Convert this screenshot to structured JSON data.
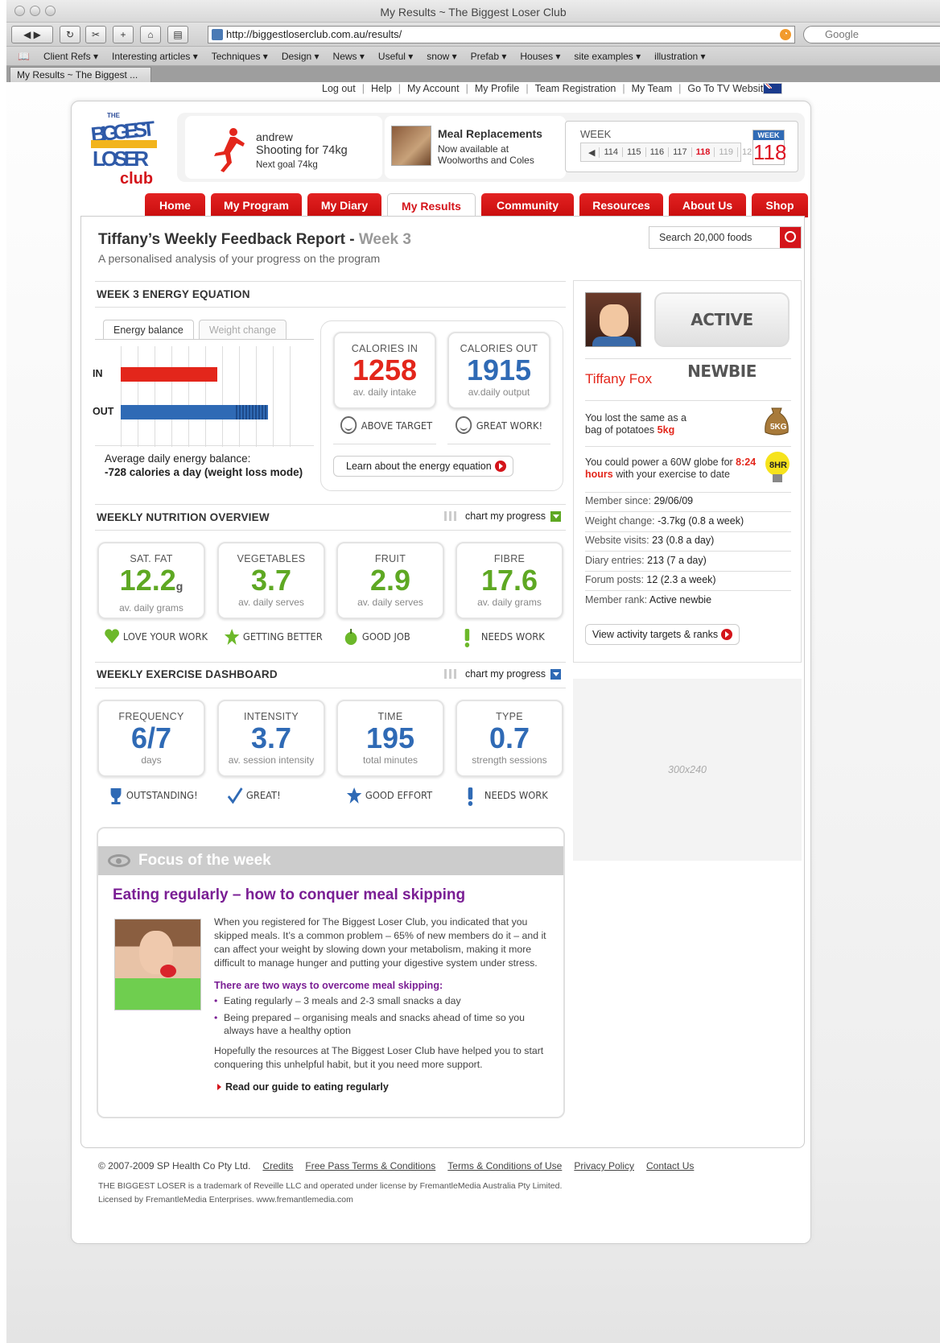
{
  "window": {
    "title": "My Results ~ The Biggest Loser Club",
    "url": "http://biggestloserclub.com.au/results/",
    "search_placeholder": "Google",
    "tab_label": "My Results ~ The Biggest ..."
  },
  "bookmarks": [
    "Client Refs ▾",
    "Interesting articles ▾",
    "Techniques ▾",
    "Design ▾",
    "News ▾",
    "Useful ▾",
    "snow ▾",
    "Prefab ▾",
    "Houses ▾",
    "site examples ▾",
    "illustration ▾"
  ],
  "topnav": [
    "Log out",
    "Help",
    "My Account",
    "My Profile",
    "Team Registration",
    "My Team",
    "Go To TV Website"
  ],
  "logo": {
    "line1": "THE",
    "line2": "BIGGEST",
    "line3": "LOSER",
    "line4": "club"
  },
  "profile": {
    "name": "andrew",
    "shooting": "Shooting for 74kg",
    "next_goal": "Next goal 74kg"
  },
  "meal": {
    "title": "Meal Replacements",
    "desc": "Now available at Woolworths and Coles"
  },
  "week": {
    "label": "WEEK",
    "numbers": [
      "114",
      "115",
      "116",
      "117",
      "118",
      "119",
      "12"
    ],
    "current": "118",
    "badge_label": "WEEK",
    "badge_value": "118"
  },
  "mainnav": [
    "Home",
    "My Program",
    "My Diary",
    "My Results",
    "Community",
    "Resources",
    "About Us",
    "Shop"
  ],
  "page": {
    "title": "Tiffany’s Weekly Feedback Report -",
    "title_week": "Week 3",
    "subtitle": "A personalised analysis of your progress on the program",
    "search_placeholder": "Search 20,000 foods"
  },
  "energy": {
    "heading": "WEEK 3 ENERGY EQUATION",
    "tab_active": "Energy balance",
    "tab_inactive": "Weight change",
    "in_label": "IN",
    "out_label": "OUT",
    "in_value": 1258,
    "out_value": 1915,
    "scale_max": 2200,
    "balance_label": "Average daily energy balance:",
    "balance_value": "-728 calories a day (weight loss mode)",
    "cal_in": {
      "title": "CALORIES IN",
      "value": "1258",
      "sub": "av. daily intake",
      "status": "ABOVE TARGET"
    },
    "cal_out": {
      "title": "CALORIES OUT",
      "value": "1915",
      "sub": "av.daily output",
      "status": "GREAT WORK!"
    },
    "learn": "Learn about the energy equation",
    "colors": {
      "in": "#e3261b",
      "out": "#2f6ab5"
    }
  },
  "nutrition": {
    "heading": "WEEKLY NUTRITION OVERVIEW",
    "chart_link": "chart my progress",
    "cards": [
      {
        "title": "SAT. FAT",
        "value": "12.2",
        "unit": "g",
        "sub": "av. daily grams",
        "status": "LOVE YOUR WORK",
        "icon": "heart-icon"
      },
      {
        "title": "VEGETABLES",
        "value": "3.7",
        "unit": "",
        "sub": "av. daily serves",
        "status": "GETTING BETTER",
        "icon": "star-icon"
      },
      {
        "title": "FRUIT",
        "value": "2.9",
        "unit": "",
        "sub": "av. daily serves",
        "status": "GOOD JOB",
        "icon": "apple-icon"
      },
      {
        "title": "FIBRE",
        "value": "17.6",
        "unit": "",
        "sub": "av. daily grams",
        "status": "NEEDS WORK",
        "icon": "exclamation-icon"
      }
    ]
  },
  "exercise": {
    "heading": "WEEKLY EXERCISE DASHBOARD",
    "chart_link": "chart my progress",
    "cards": [
      {
        "title": "FREQUENCY",
        "value": "6/7",
        "sub": "days",
        "status": "OUTSTANDING!",
        "icon": "trophy-icon"
      },
      {
        "title": "INTENSITY",
        "value": "3.7",
        "sub": "av. session intensity",
        "status": "GREAT!",
        "icon": "check-icon"
      },
      {
        "title": "TIME",
        "value": "195",
        "sub": "total minutes",
        "status": "GOOD EFFORT",
        "icon": "star-icon"
      },
      {
        "title": "TYPE",
        "value": "0.7",
        "sub": "strength sessions",
        "status": "NEEDS WORK",
        "icon": "exclamation-icon"
      }
    ]
  },
  "sidebar": {
    "rank_badge": "ACTIVE NEWBIE",
    "name": "Tiffany Fox",
    "fact1": "You lost the same as a bag of potatoes",
    "fact1_highlight": "5kg",
    "fact1_icon": "5KG",
    "fact2_a": "You could power a 60W globe for",
    "fact2_highlight": "8:24 hours",
    "fact2_b": "with your exercise to date",
    "fact2_icon": "8HR",
    "stats": [
      {
        "label": "Member since:",
        "value": "29/06/09"
      },
      {
        "label": "Weight change:",
        "value": "-3.7kg (0.8 a week)"
      },
      {
        "label": "Website visits:",
        "value": "23 (0.8 a day)"
      },
      {
        "label": "Diary entries:",
        "value": "213 (7 a day)"
      },
      {
        "label": "Forum posts:",
        "value": "12 (2.3 a week)"
      },
      {
        "label": "Member rank:",
        "value": "Active newbie"
      }
    ],
    "view_button": "View activity targets & ranks"
  },
  "ad": {
    "label": "300x240"
  },
  "focus": {
    "header": "Focus of the week",
    "title": "Eating regularly – how to conquer meal skipping",
    "p1": "When you registered for The Biggest Loser Club, you indicated that you skipped meals. It’s a common problem – 65% of new members do it – and it can affect your weight by slowing down your metabolism, making it more difficult to manage hunger and putting your digestive system under stress.",
    "subhead": "There are two ways to overcome meal skipping:",
    "bullets": [
      "Eating regularly – 3 meals and 2-3 small snacks a day",
      "Being prepared – organising meals and snacks ahead of time so you always have a healthy option"
    ],
    "p2": "Hopefully the resources at The Biggest Loser Club have helped you to start conquering this unhelpful habit, but it you need more support.",
    "link": "Read our guide to eating regularly"
  },
  "footer": {
    "copyright": "© 2007-2009 SP Health Co Pty Ltd.",
    "links": [
      "Credits",
      "Free Pass Terms & Conditions",
      "Terms & Conditions of Use",
      "Privacy Policy",
      "Contact Us"
    ],
    "legal1": "THE BIGGEST LOSER is a trademark of Reveille LLC and operated under license by FremantleMedia Australia Pty Limited.",
    "legal2": "Licensed by FremantleMedia Enterprises. www.fremantlemedia.com"
  }
}
